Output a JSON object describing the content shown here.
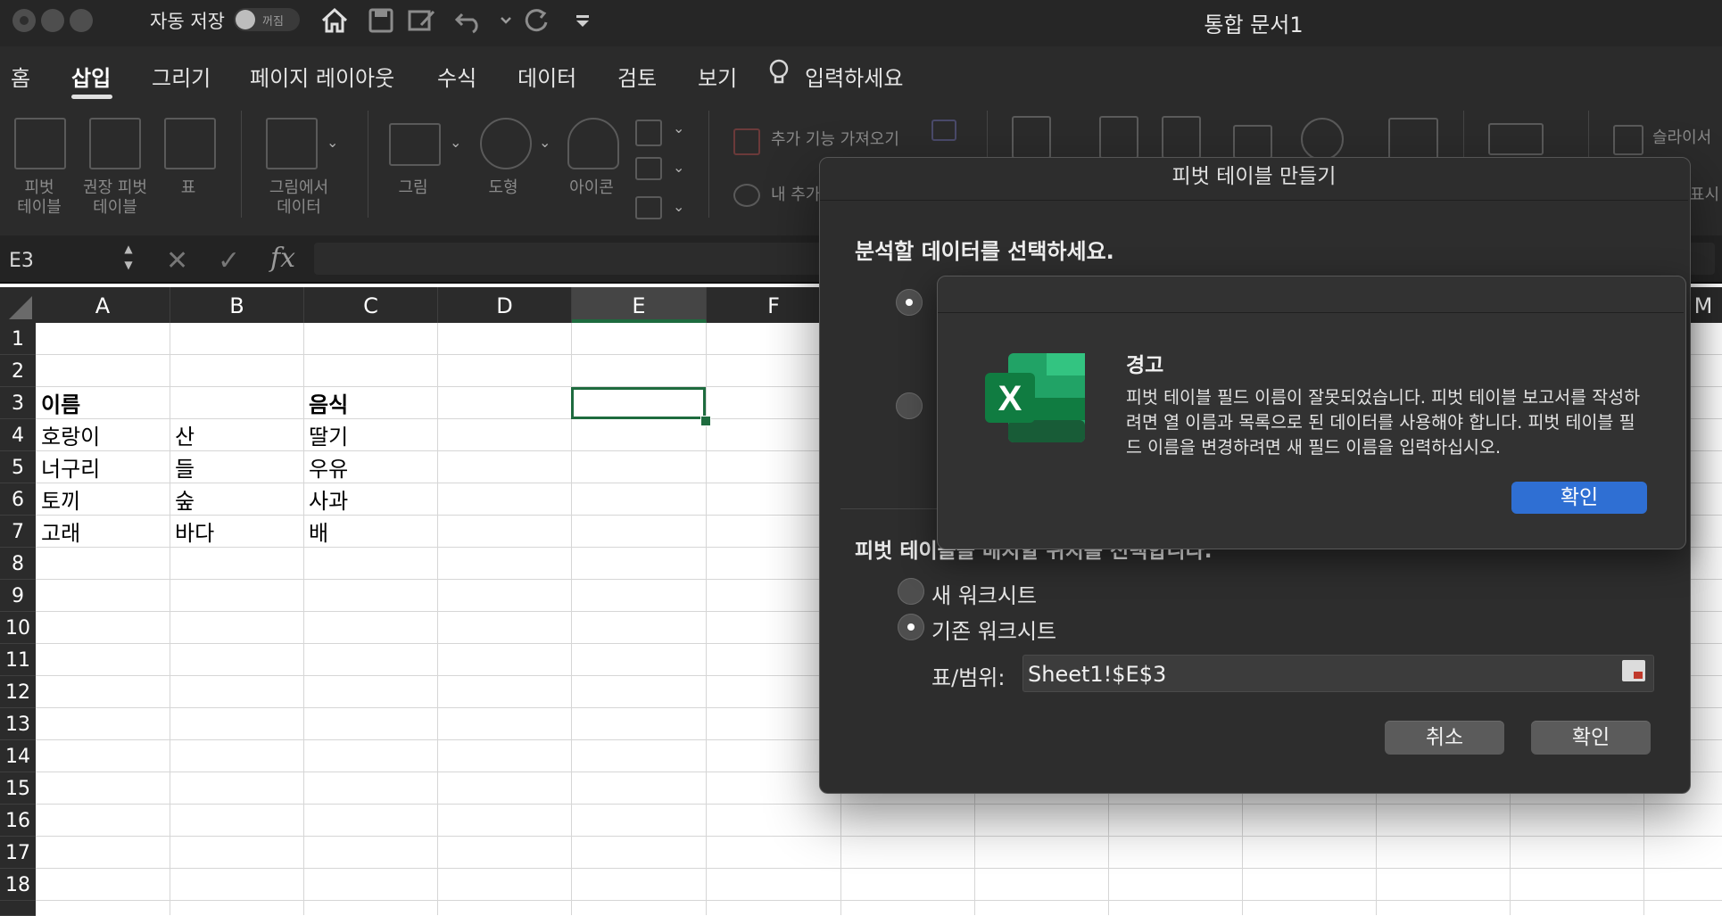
{
  "titlebar": {
    "autosave_label": "자동 저장",
    "autosave_state": "꺼짐",
    "document_title": "통합 문서1"
  },
  "tabs": [
    {
      "label": "홈"
    },
    {
      "label": "삽입",
      "active": true
    },
    {
      "label": "그리기"
    },
    {
      "label": "페이지 레이아웃"
    },
    {
      "label": "수식"
    },
    {
      "label": "데이터"
    },
    {
      "label": "검토"
    },
    {
      "label": "보기"
    }
  ],
  "tell_me": "입력하세요",
  "ribbon": {
    "pivot_table": "피벗\n테이블",
    "recommended_pivot": "권장 피벗\n테이블",
    "table": "표",
    "from_picture": "그림에서\n데이터",
    "picture": "그림",
    "shapes": "도형",
    "icons": "아이콘",
    "get_addins": "추가 기능 가져오기",
    "my_addins": "내 추가",
    "slicer": "슬라이서",
    "display": "표시"
  },
  "formula_bar": {
    "name_box": "E3",
    "fx": "fx",
    "formula": ""
  },
  "columns": [
    "A",
    "B",
    "C",
    "D",
    "E",
    "F",
    "M"
  ],
  "rows": [
    "1",
    "2",
    "3",
    "4",
    "5",
    "6",
    "7",
    "8",
    "9",
    "10",
    "11",
    "12",
    "13",
    "14",
    "15",
    "16",
    "17",
    "18"
  ],
  "cells": {
    "A3": "이름",
    "C3": "음식",
    "A4": "호랑이",
    "B4": "산",
    "C4": "딸기",
    "A5": "너구리",
    "B5": "들",
    "C5": "우유",
    "A6": "토끼",
    "B6": "숲",
    "C6": "사과",
    "A7": "고래",
    "B7": "바다",
    "C7": "배"
  },
  "pivot_dialog": {
    "title": "피벗 테이블 만들기",
    "prompt": "분석할 데이터를 선택하세요.",
    "placement_prompt": "피벗 테이블을 배치할 위치를 선택합니다.",
    "option_new_sheet": "새 워크시트",
    "option_existing_sheet": "기존 워크시트",
    "range_label": "표/범위:",
    "range_value": "Sheet1!$E$3",
    "cancel": "취소",
    "ok": "확인"
  },
  "alert": {
    "title": "경고",
    "message": "피벗 테이블 필드 이름이 잘못되었습니다. 피벗 테이블 보고서를 작성하려면 열 이름과 목록으로 된 데이터를 사용해야 합니다. 피벗 테이블 필드 이름을 변경하려면 새 필드 이름을 입력하십시오.",
    "ok": "확인"
  },
  "colors": {
    "accent_green": "#1e6b3e",
    "alert_button_blue": "#2f6fd3",
    "excel_logo": "#107c41"
  }
}
